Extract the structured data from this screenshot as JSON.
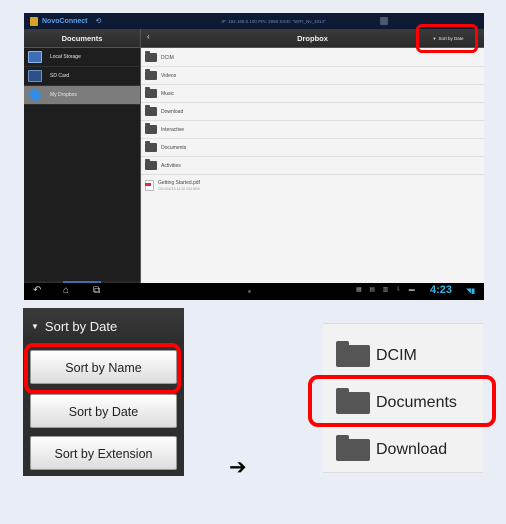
{
  "statusbar": {
    "app_name": "NovoConnect",
    "connection": "IP: 192.168.0.100   PIN: 2956   SSID: \"WIFI_Nv_1014\""
  },
  "left_pane": {
    "title": "Documents",
    "items": [
      {
        "label": "Local Storage",
        "icon": "tablet-storage-icon"
      },
      {
        "label": "SD Card",
        "icon": "sd-card-icon"
      },
      {
        "label": "My Dropbox",
        "icon": "dropbox-icon",
        "selected": true
      }
    ]
  },
  "right_pane": {
    "title": "Dropbox",
    "sort_button": "Sort by Date",
    "folders": [
      "DCIM",
      "Videos",
      "Music",
      "Download",
      "Interactive",
      "Documents",
      "Activities"
    ],
    "file": {
      "name": "Getting Started.pdf",
      "meta": "2014/02/13 14:32  243.5KB"
    }
  },
  "navbar": {
    "clock": "4:23"
  },
  "sort_menu": {
    "header": "Sort by Date",
    "options": [
      "Sort by Name",
      "Sort by Date",
      "Sort by Extension"
    ]
  },
  "arrow": "➔",
  "zoom_list": {
    "folders": [
      "DCIM",
      "Documents",
      "Download"
    ]
  },
  "colors": {
    "highlight": "#ff0000",
    "accent_blue": "#33b5e5"
  }
}
